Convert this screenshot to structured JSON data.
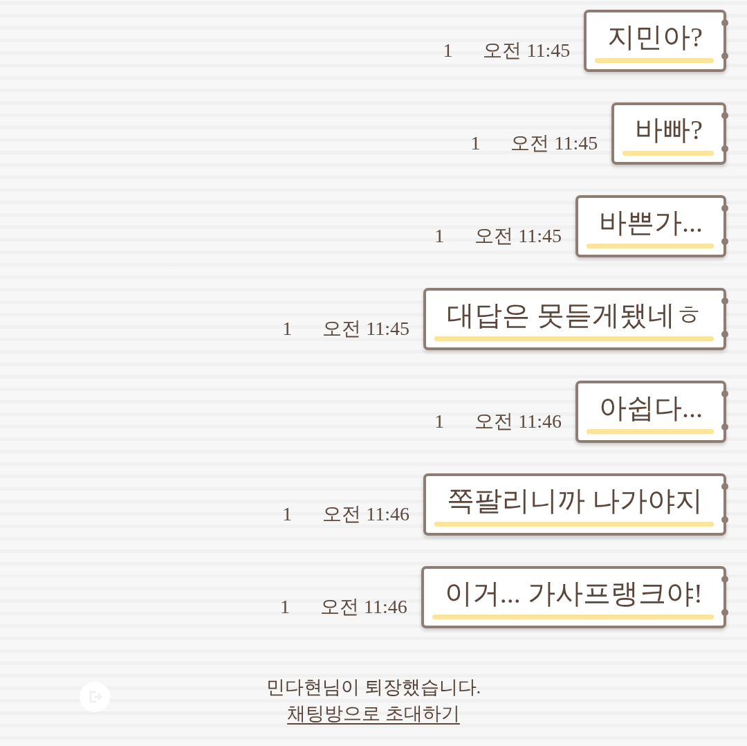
{
  "messages": [
    {
      "text": "지민아?",
      "time": "오전 11:45",
      "unread": "1"
    },
    {
      "text": "바빠?",
      "time": "오전 11:45",
      "unread": "1"
    },
    {
      "text": "바쁜가...",
      "time": "오전 11:45",
      "unread": "1"
    },
    {
      "text": "대답은 못듣게됐네ㅎ",
      "time": "오전 11:45",
      "unread": "1"
    },
    {
      "text": "아쉽다...",
      "time": "오전 11:46",
      "unread": "1"
    },
    {
      "text": "쪽팔리니까 나가야지",
      "time": "오전 11:46",
      "unread": "1"
    },
    {
      "text": "이거... 가사프랭크야!",
      "time": "오전 11:46",
      "unread": "1"
    }
  ],
  "system_notice": {
    "text": "민다현님이 퇴장했습니다.",
    "link": "채팅방으로 초대하기"
  }
}
